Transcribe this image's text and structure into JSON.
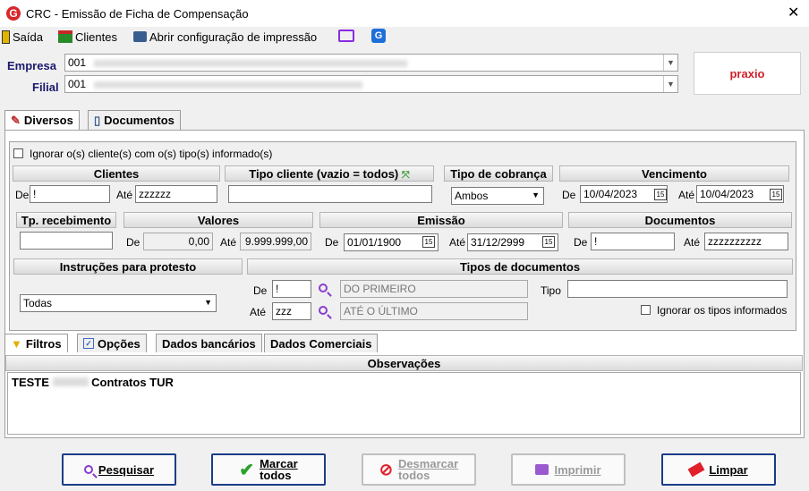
{
  "window": {
    "title": "CRC - Emissão de Ficha de Compensação",
    "app_icon": "G"
  },
  "toolbar": {
    "exit": "Saída",
    "clients": "Clientes",
    "print_config": "Abrir configuração de impressão"
  },
  "company": {
    "empresa_label": "Empresa",
    "empresa_code": "001",
    "filial_label": "Filial",
    "filial_code": "001",
    "logo_text": "praxio"
  },
  "tabs_top": [
    "Diversos",
    "Documentos"
  ],
  "filters": {
    "ignore_clients_label": "Ignorar o(s) cliente(s) com o(s) tipo(s) informado(s)",
    "clientes": {
      "title": "Clientes",
      "de_label": "De",
      "de_value": "!",
      "ate_label": "Até",
      "ate_value": "zzzzzz"
    },
    "tipo_cliente": {
      "title": "Tipo cliente (vazio = todos)",
      "value": ""
    },
    "tipo_cobranca": {
      "title": "Tipo de cobrança",
      "value": "Ambos"
    },
    "vencimento": {
      "title": "Vencimento",
      "de_label": "De",
      "de_value": "10/04/2023",
      "ate_label": "Até",
      "ate_value": "10/04/2023"
    },
    "tp_recebimento": {
      "title": "Tp. recebimento",
      "value": ""
    },
    "valores": {
      "title": "Valores",
      "de_label": "De",
      "de_value": "0,00",
      "ate_label": "Até",
      "ate_value": "9.999.999,00"
    },
    "emissao": {
      "title": "Emissão",
      "de_label": "De",
      "de_value": "01/01/1900",
      "ate_label": "Até",
      "ate_value": "31/12/2999"
    },
    "documentos": {
      "title": "Documentos",
      "de_label": "De",
      "de_value": "!",
      "ate_label": "Até",
      "ate_value": "zzzzzzzzzz"
    },
    "instrucoes": {
      "title": "Instruções para protesto",
      "value": "Todas"
    },
    "tipos_doc": {
      "title": "Tipos de documentos",
      "de_label": "De",
      "de_value": "!",
      "de_desc": "DO PRIMEIRO",
      "ate_label": "Até",
      "ate_value": "zzz",
      "ate_desc": "ATÉ O ÚLTIMO",
      "tipo_label": "Tipo",
      "tipo_value": "",
      "ignore_label": "Ignorar os tipos informados"
    }
  },
  "tabs_bottom": [
    "Filtros",
    "Opções",
    "Dados bancários",
    "Dados Comerciais"
  ],
  "observacoes": {
    "title": "Observações",
    "text_start": "TESTE",
    "text_end": "Contratos TUR"
  },
  "buttons": {
    "pesquisar": "Pesquisar",
    "marcar": "Marcar",
    "marcar2": "todos",
    "desmarcar": "Desmarcar",
    "desmarcar2": "todos",
    "imprimir": "Imprimir",
    "limpar": "Limpar"
  }
}
